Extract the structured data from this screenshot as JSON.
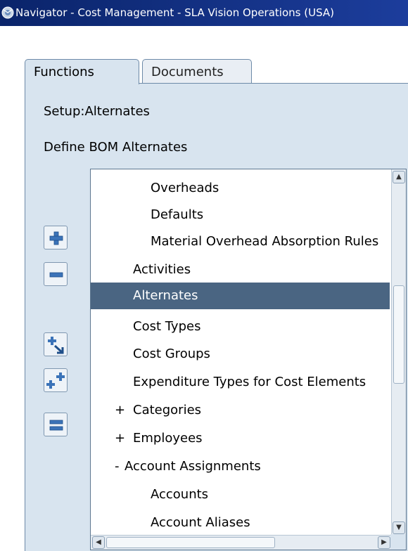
{
  "window": {
    "title": "Navigator - Cost Management - SLA Vision Operations (USA)",
    "icon": "oracle-app-icon"
  },
  "tabs": [
    {
      "label": "Functions",
      "active": true
    },
    {
      "label": "Documents",
      "active": false
    }
  ],
  "breadcrumb": "Setup:Alternates",
  "function_description": "Define BOM Alternates",
  "toolbar": {
    "expand_icon": "plus-icon",
    "collapse_icon": "minus-icon",
    "expand_branch_icon": "expand-branch-icon",
    "expand_all_icon": "expand-all-icon",
    "collapse_all_icon": "collapse-all-icon"
  },
  "tree": {
    "items": [
      {
        "prefix": "",
        "label": "Overheads",
        "selected": false
      },
      {
        "prefix": "",
        "label": "Defaults",
        "selected": false
      },
      {
        "prefix": "",
        "label": "Material Overhead Absorption Rules",
        "selected": false
      },
      {
        "prefix": "",
        "label": "Activities",
        "selected": false
      },
      {
        "prefix": "",
        "label": "Alternates",
        "selected": true
      },
      {
        "prefix": "",
        "label": "Cost Types",
        "selected": false
      },
      {
        "prefix": "",
        "label": "Cost Groups",
        "selected": false
      },
      {
        "prefix": "",
        "label": "Expenditure Types for Cost Elements",
        "selected": false
      },
      {
        "prefix": "+",
        "label": "Categories",
        "selected": false
      },
      {
        "prefix": "+",
        "label": "Employees",
        "selected": false
      },
      {
        "prefix": "-",
        "label": "Account Assignments",
        "selected": false
      },
      {
        "prefix": "",
        "label": "Accounts",
        "selected": false
      },
      {
        "prefix": "",
        "label": "Account Aliases",
        "selected": false
      }
    ]
  },
  "colors": {
    "selection": "#4a6582",
    "panel": "#d8e4ef",
    "titlebar": "#0a246a"
  }
}
